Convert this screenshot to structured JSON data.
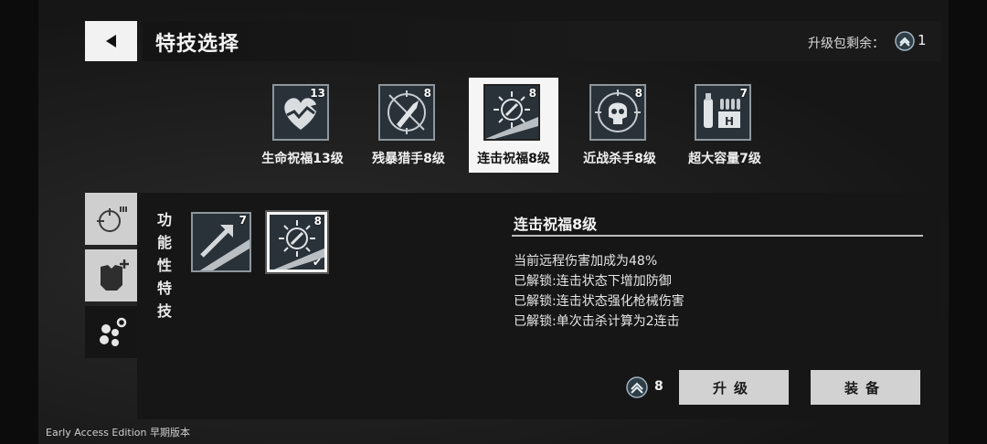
{
  "header": {
    "back_icon": "back-arrow-icon",
    "title": "特技选择",
    "remain_label": "升级包剩余：",
    "remain_icon": "upgrade-pack-icon",
    "remain_count": "1"
  },
  "perks": [
    {
      "name": "生命祝福13级",
      "level": "13",
      "icon": "heart-heal-icon",
      "selected": false
    },
    {
      "name": "残暴猎手8级",
      "level": "8",
      "icon": "knife-crosshair-icon",
      "selected": false
    },
    {
      "name": "连击祝福8级",
      "level": "8",
      "icon": "burst-bullet-icon",
      "selected": true
    },
    {
      "name": "近战杀手8级",
      "level": "8",
      "icon": "skull-crosshair-icon",
      "selected": false
    },
    {
      "name": "超大容量7级",
      "level": "7",
      "icon": "ammo-crate-icon",
      "selected": false
    }
  ],
  "side_tabs": [
    {
      "icon": "crosshair-icon",
      "active": false
    },
    {
      "icon": "armor-plus-icon",
      "active": false
    },
    {
      "icon": "gear-cluster-icon",
      "active": true
    }
  ],
  "category_label": "功能性特技",
  "sub_perks": [
    {
      "level": "7",
      "icon": "arrow-upgrade-icon",
      "selected": false
    },
    {
      "level": "8",
      "icon": "burst-bullet-icon",
      "selected": true,
      "equipped": true
    }
  ],
  "detail": {
    "title": "连击祝福8级",
    "lines": [
      "当前远程伤害加成为48%",
      "已解锁:连击状态下增加防御",
      "已解锁:连击状态强化枪械伤害",
      "已解锁:单次击杀计算为2连击"
    ]
  },
  "actions": {
    "cost_icon": "upgrade-pack-icon",
    "cost": "8",
    "upgrade_label": "升级",
    "equip_label": "装备"
  },
  "footer": "Early Access Edition 早期版本"
}
